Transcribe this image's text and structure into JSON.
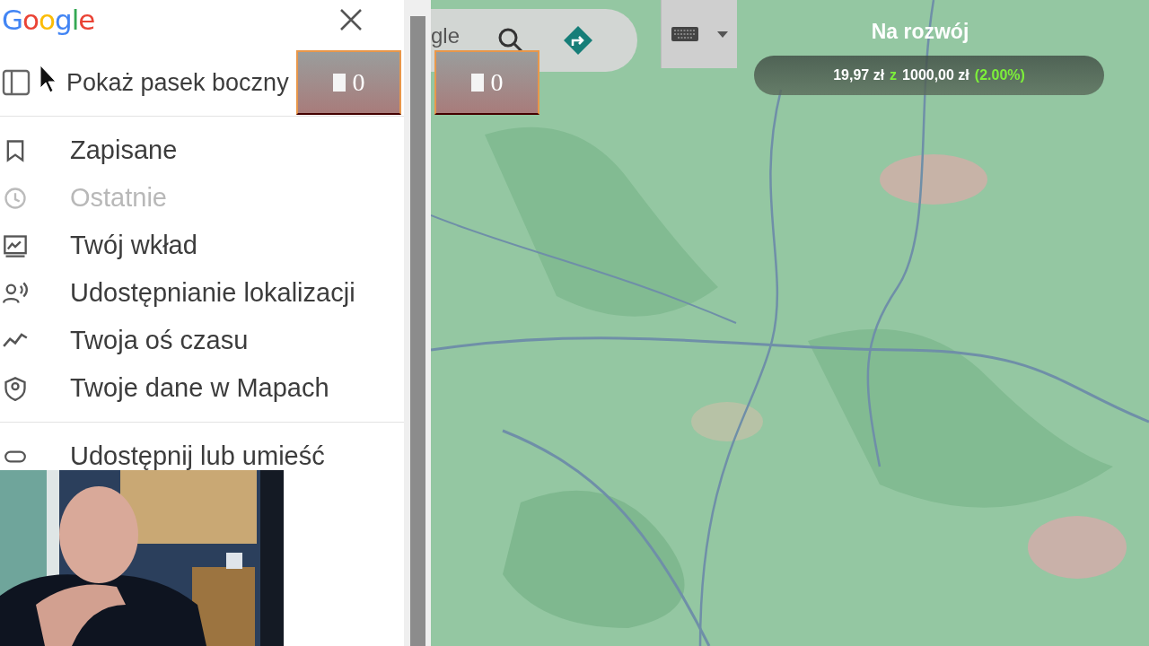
{
  "sidebar": {
    "logo": "Google",
    "show_sidebar": "Pokaż pasek boczny",
    "items": [
      {
        "label": "Zapisane",
        "disabled": false
      },
      {
        "label": "Ostatnie",
        "disabled": true
      },
      {
        "label": "Twój wkład",
        "disabled": false
      },
      {
        "label": "Udostępnianie lokalizacji",
        "disabled": false
      },
      {
        "label": "Twoja oś czasu",
        "disabled": false
      },
      {
        "label": "Twoje dane w Mapach",
        "disabled": false
      }
    ],
    "share": {
      "label": "Udostępnij lub umieść"
    }
  },
  "search": {
    "placeholder": "gle"
  },
  "counters": [
    {
      "value": "0"
    },
    {
      "value": "0"
    }
  ],
  "goal": {
    "title": "Na rozwój",
    "raised": "19,97 zł",
    "sep": "z",
    "target": "1000,00 zł",
    "percent": "(2.00%)"
  }
}
